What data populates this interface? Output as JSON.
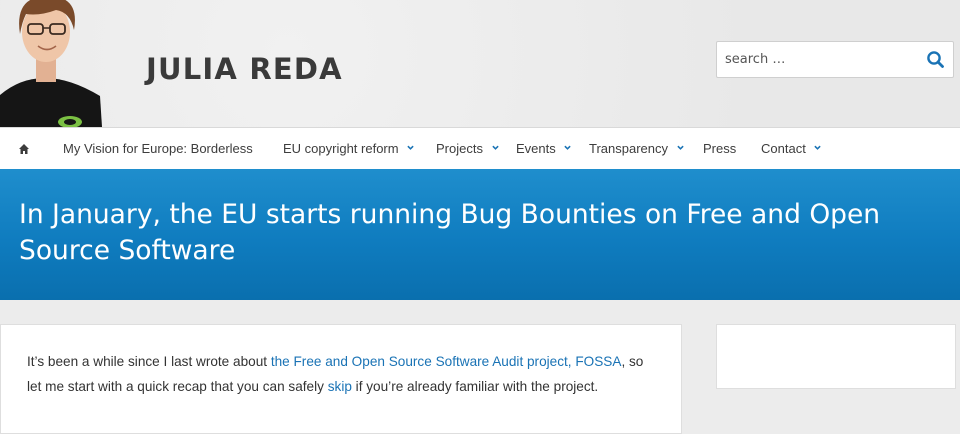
{
  "site": {
    "title": "JULIA REDA"
  },
  "search": {
    "placeholder": "search …"
  },
  "nav": {
    "home_icon": "home-icon",
    "items": [
      {
        "label": "My Vision for Europe: Borderless",
        "dropdown": false
      },
      {
        "label": "EU copyright reform",
        "dropdown": true
      },
      {
        "label": "Projects",
        "dropdown": true
      },
      {
        "label": "Events",
        "dropdown": true
      },
      {
        "label": "Transparency",
        "dropdown": true
      },
      {
        "label": "Press",
        "dropdown": false
      },
      {
        "label": "Contact",
        "dropdown": true
      }
    ]
  },
  "hero": {
    "title": "In January, the EU starts running Bug Bounties on Free and Open Source Software"
  },
  "article": {
    "p1_before": "It’s been a while since I last wrote about ",
    "p1_link1": "the Free and Open Source Software Audit project, FOSSA",
    "p1_middle": ", so let me start with a quick recap that you can safely ",
    "p1_link2": "skip",
    "p1_after": " if you’re already familiar with the project."
  },
  "colors": {
    "accent": "#1a73b5",
    "hero_blue": "#0f7cbf",
    "nav_text": "#3d3d3d",
    "title_text": "#3a3a3a"
  }
}
